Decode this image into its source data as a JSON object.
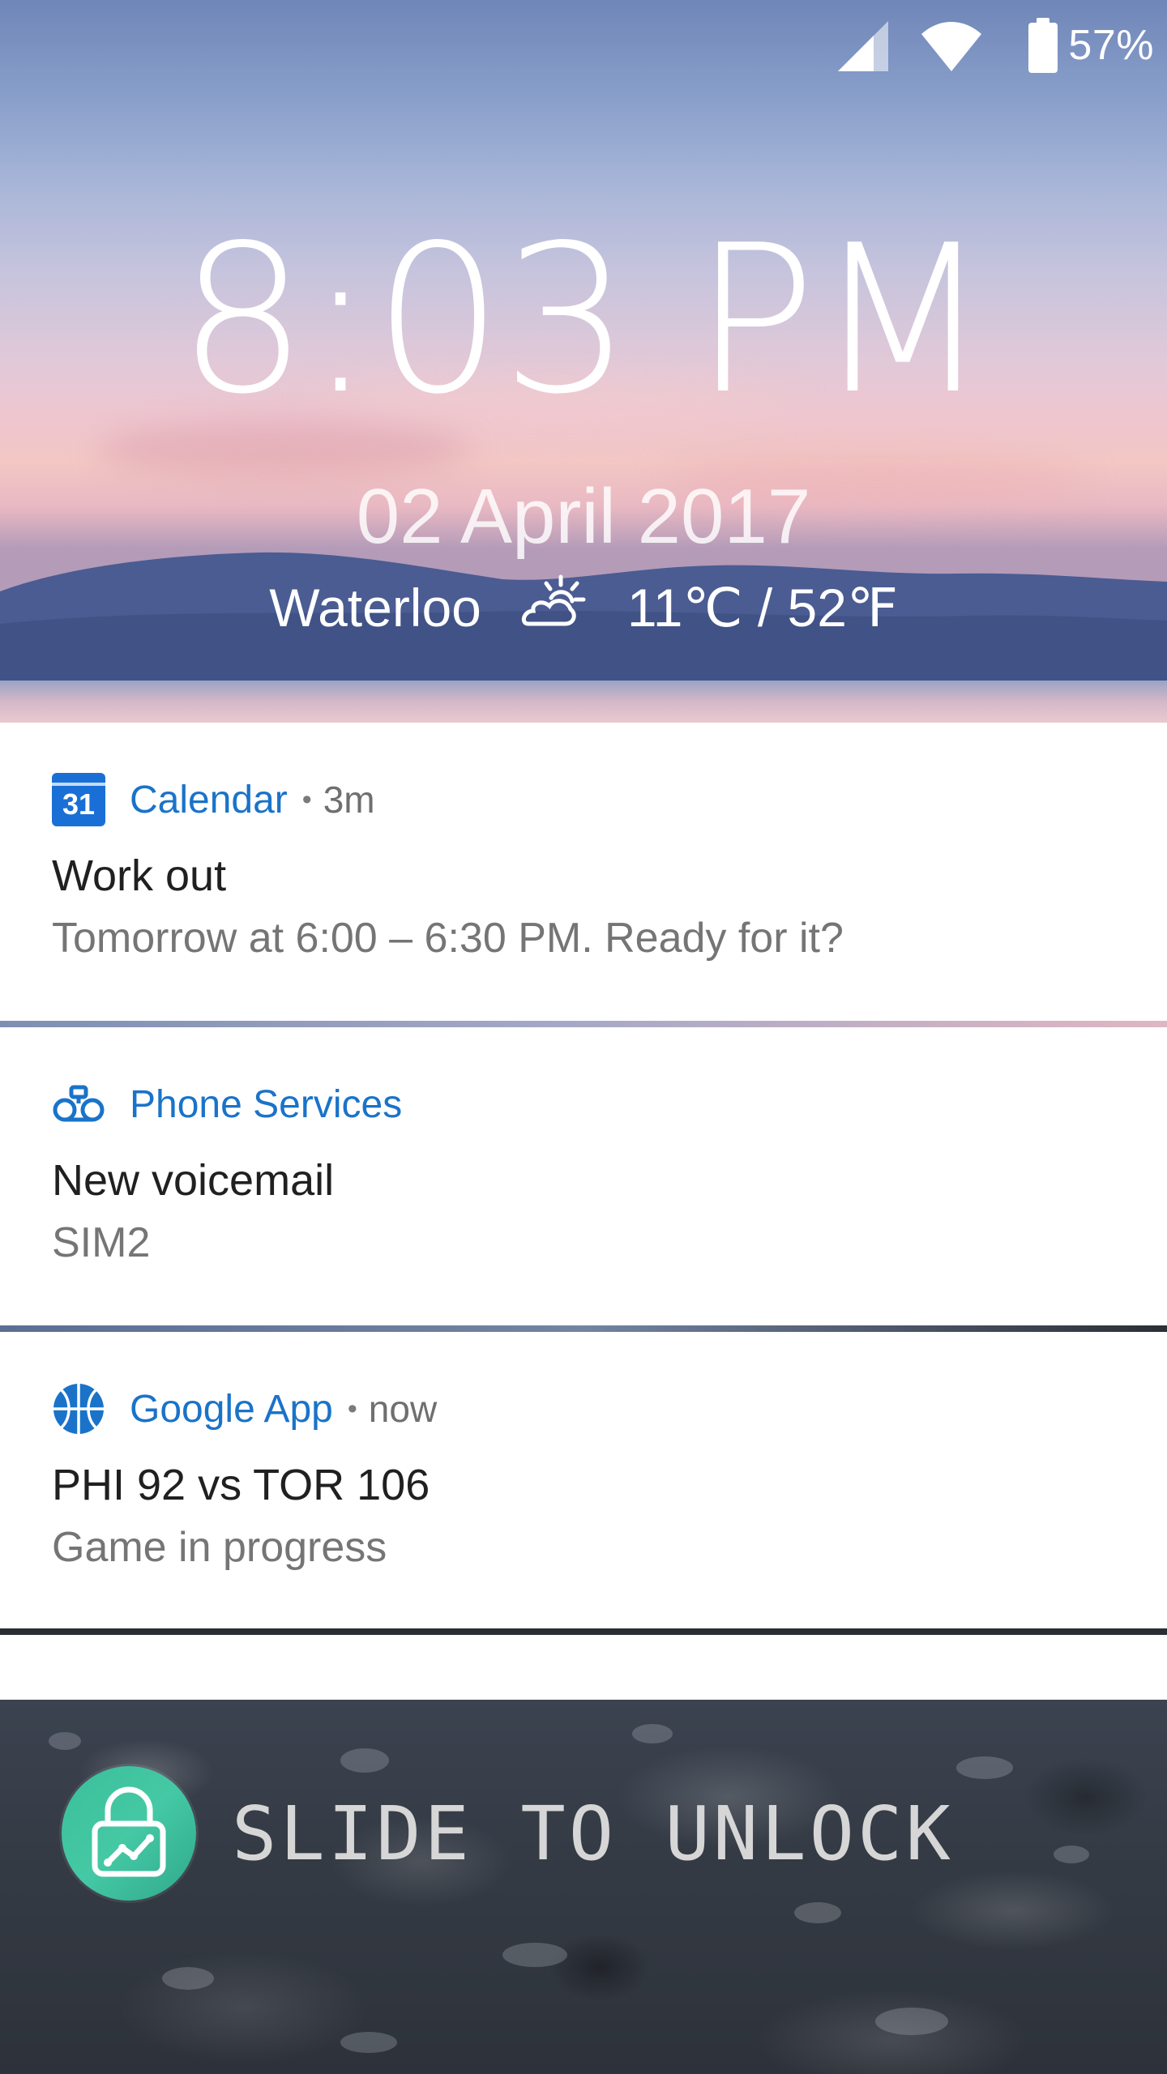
{
  "status_bar": {
    "battery_percent": "57%",
    "icons": [
      "cell-signal-icon",
      "wifi-icon",
      "battery-icon"
    ]
  },
  "lockscreen": {
    "time": "8:03 PM",
    "date": "02 April 2017",
    "weather": {
      "location": "Waterloo",
      "icon": "partly-cloudy-night-icon",
      "temperature": "11℃ / 52℉"
    }
  },
  "notifications": [
    {
      "app": "Calendar",
      "app_icon": "calendar-icon",
      "app_icon_text": "31",
      "time": "3m",
      "title": "Work out",
      "text": "Tomorrow at 6:00 – 6:30 PM. Ready for it?"
    },
    {
      "app": "Phone Services",
      "app_icon": "voicemail-icon",
      "time": "",
      "title": "New voicemail",
      "text": "SIM2"
    },
    {
      "app": "Google App",
      "app_icon": "basketball-icon",
      "time": "now",
      "title": "PHI 92 vs TOR 106",
      "text": "Game in progress"
    }
  ],
  "unlock": {
    "label": "SLIDE TO UNLOCK",
    "icon": "lock-icon",
    "color": "#3bbf9a"
  },
  "colors": {
    "app_name": "#1a73c9",
    "notification_bg": "#ffffff"
  }
}
